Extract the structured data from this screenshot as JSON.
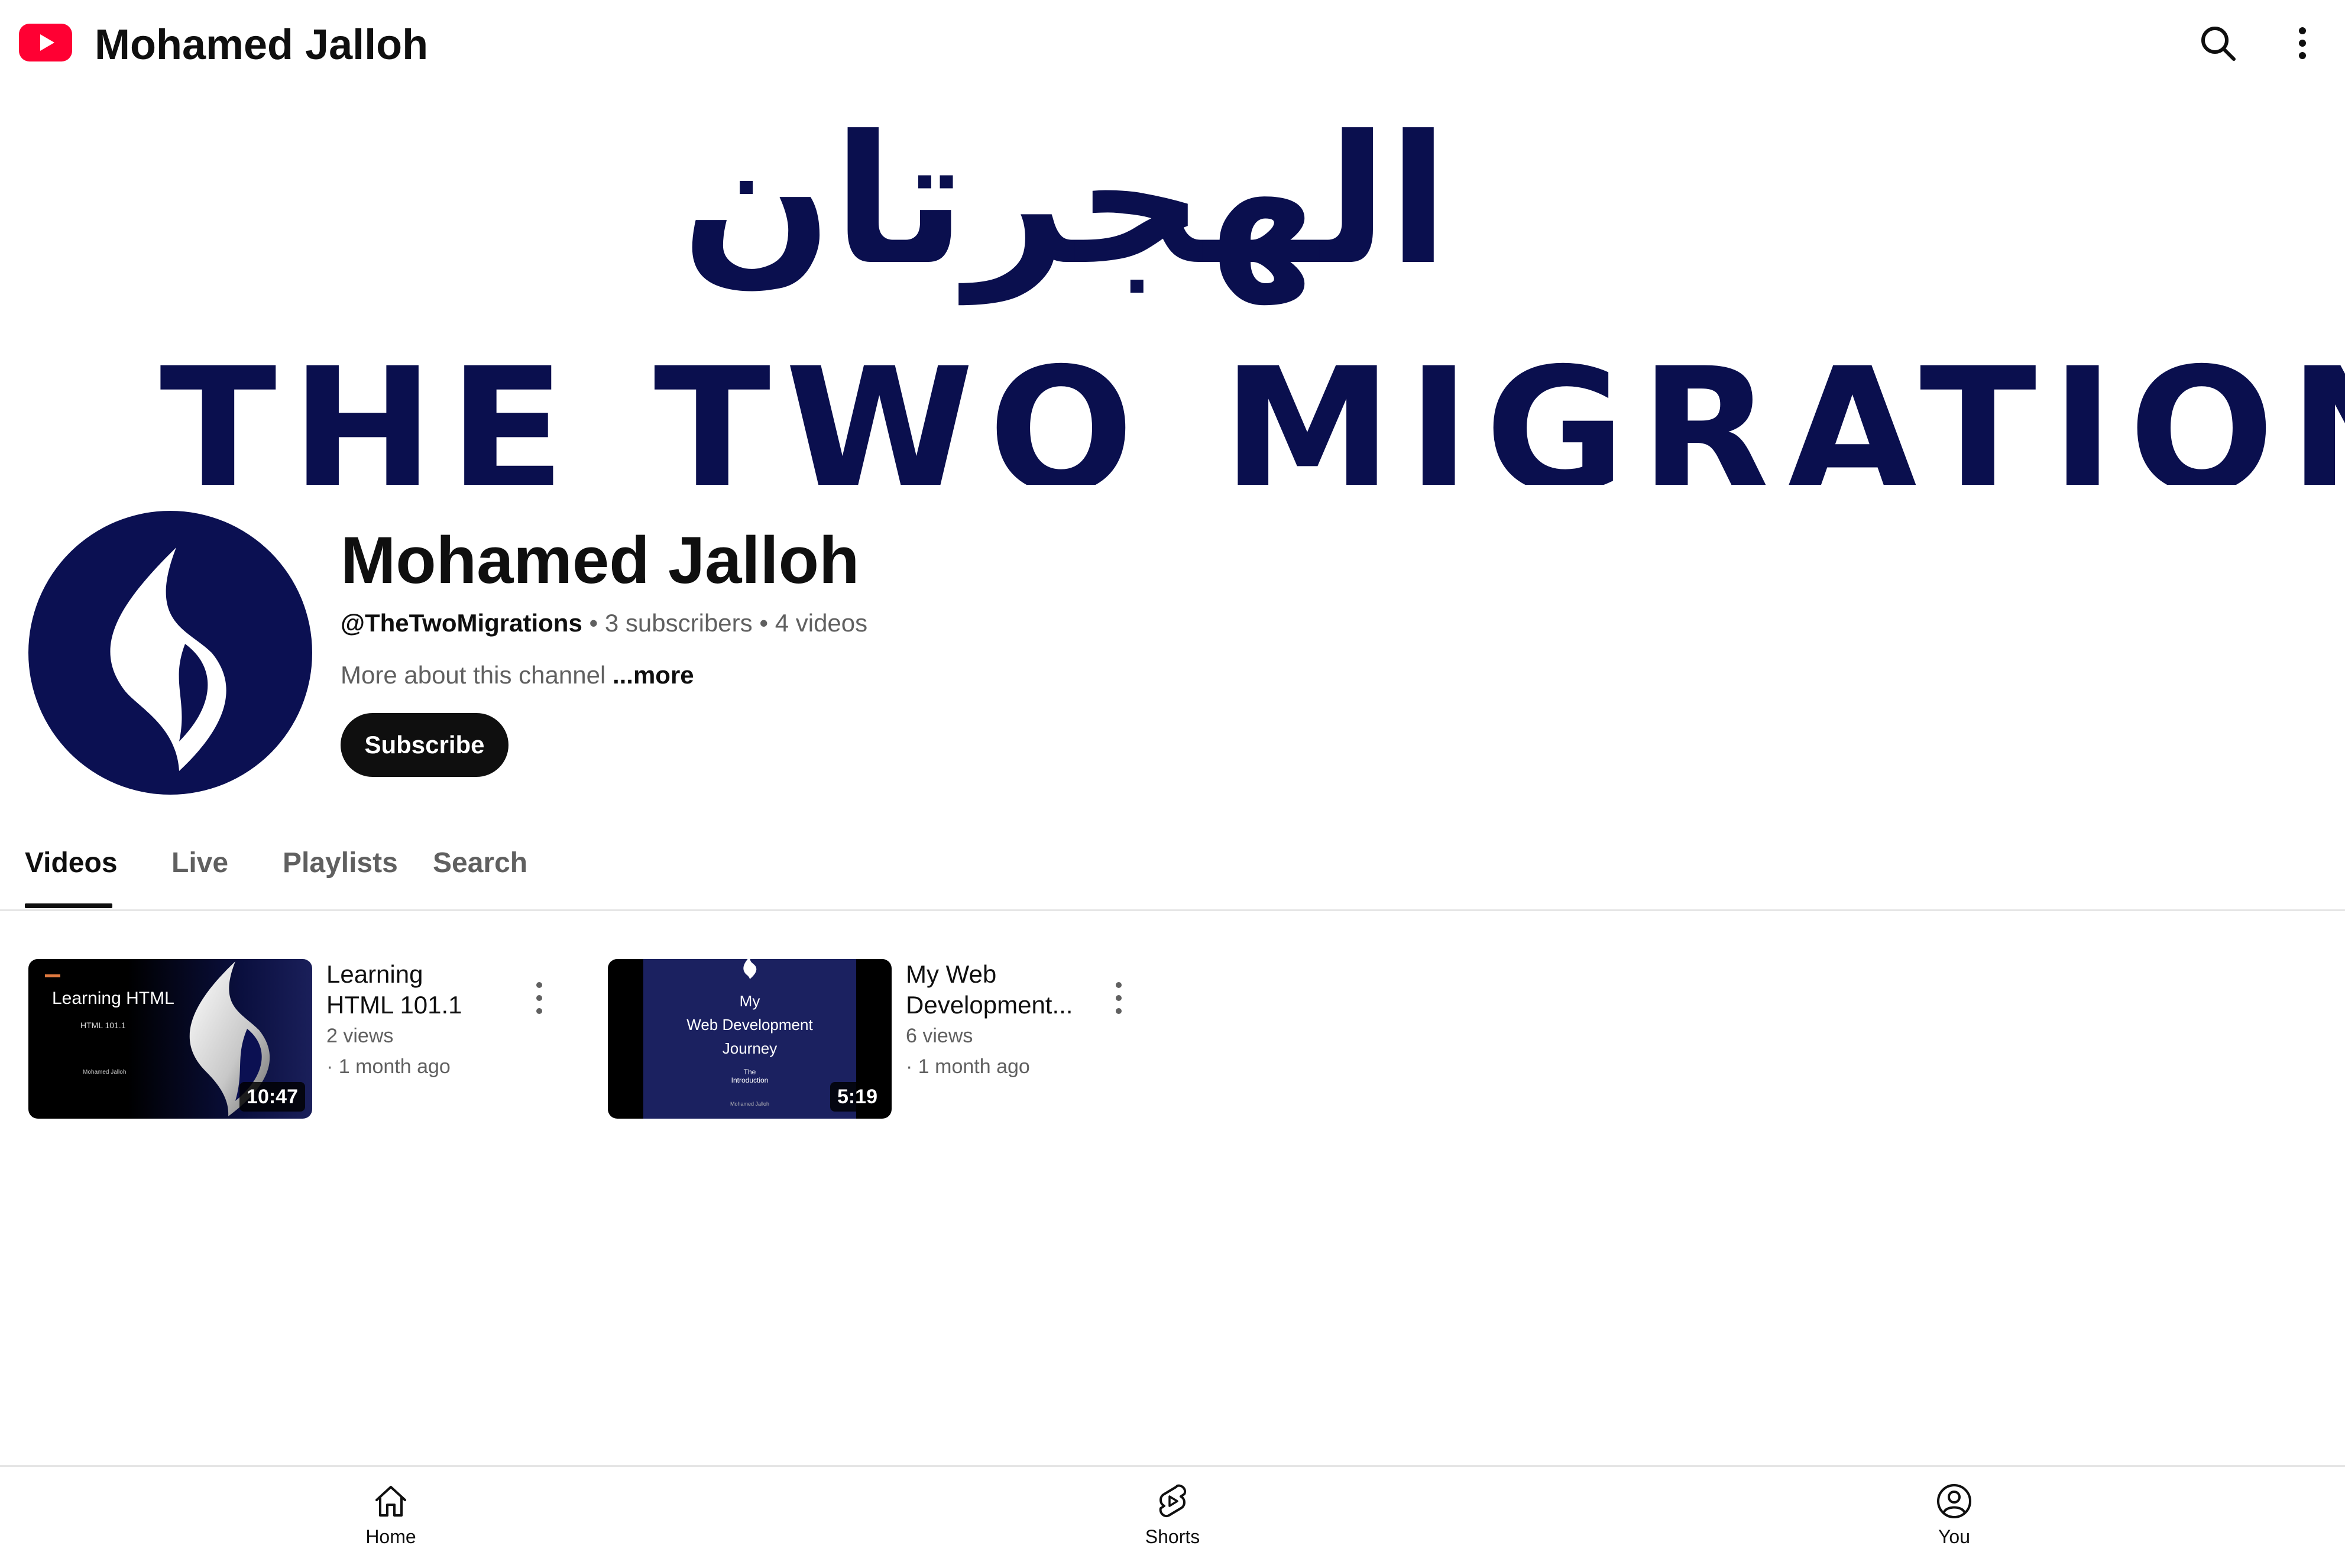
{
  "header": {
    "title": "Mohamed Jalloh",
    "logo_icon": "youtube-logo-icon",
    "search_icon": "search-icon",
    "menu_icon": "more-vertical-icon",
    "brand_color": "#ff0033"
  },
  "banner": {
    "arabic_text": "الهجرتان",
    "english_text": "THE TWO MIGRATIONS",
    "text_color": "#0a0f4e"
  },
  "channel": {
    "name": "Mohamed Jalloh",
    "handle": "@TheTwoMigrations",
    "separator": "•",
    "subscribers": "3 subscribers",
    "videos": "4 videos",
    "about": "More about this channel",
    "more_link": "...more",
    "subscribe_label": "Subscribe",
    "avatar_icon": "flame-logo-icon",
    "avatar_color": "#0b1052"
  },
  "tabs": [
    {
      "label": "Videos",
      "active": true
    },
    {
      "label": "Live",
      "active": false
    },
    {
      "label": "Playlists",
      "active": false
    },
    {
      "label": "Search",
      "active": false
    }
  ],
  "videos": [
    {
      "title": "Learning HTML 101.1",
      "views": "2 views",
      "age": "· 1 month ago",
      "duration": "10:47",
      "thumbnail": {
        "title": "Learning HTML",
        "subtitle": "HTML 101.1",
        "author": "Mohamed Jalloh"
      }
    },
    {
      "title": "My Web Development...",
      "views": "6 views",
      "age": "· 1 month ago",
      "duration": "5:19",
      "thumbnail": {
        "line1": "My",
        "line2": "Web Development",
        "line3": "Journey",
        "line4": "The",
        "line5": "Introduction",
        "author": "Mohamed Jalloh"
      }
    }
  ],
  "bottom_nav": [
    {
      "label": "Home",
      "icon": "home-icon"
    },
    {
      "label": "Shorts",
      "icon": "shorts-icon"
    },
    {
      "label": "You",
      "icon": "account-circle-icon"
    }
  ]
}
